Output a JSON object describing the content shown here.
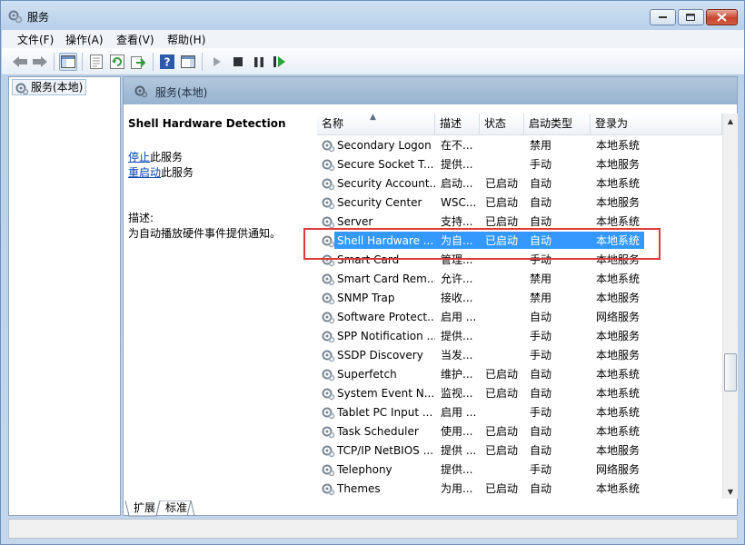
{
  "window": {
    "title": "服务"
  },
  "menu": [
    "文件(F)",
    "操作(A)",
    "查看(V)",
    "帮助(H)"
  ],
  "tree": {
    "root_label": "服务(本地)"
  },
  "pane_header": "服务(本地)",
  "detail": {
    "service_name": "Shell Hardware Detection",
    "stop_link": "停止",
    "stop_suffix": "此服务",
    "restart_link": "重启动",
    "restart_suffix": "此服务",
    "desc_label": "描述:",
    "desc_text": "为自动播放硬件事件提供通知。"
  },
  "columns": [
    "名称",
    "描述",
    "状态",
    "启动类型",
    "登录为"
  ],
  "rows": [
    {
      "name": "Secondary Logon",
      "desc": "在不...",
      "status": "",
      "start": "禁用",
      "logon": "本地系统"
    },
    {
      "name": "Secure Socket T...",
      "desc": "提供...",
      "status": "",
      "start": "手动",
      "logon": "本地服务"
    },
    {
      "name": "Security Account...",
      "desc": "启动...",
      "status": "已启动",
      "start": "自动",
      "logon": "本地系统"
    },
    {
      "name": "Security Center",
      "desc": "WSC...",
      "status": "已启动",
      "start": "自动",
      "logon": "本地服务"
    },
    {
      "name": "Server",
      "desc": "支持...",
      "status": "已启动",
      "start": "自动",
      "logon": "本地系统"
    },
    {
      "name": "Shell Hardware ...",
      "desc": "为自...",
      "status": "已启动",
      "start": "自动",
      "logon": "本地系统",
      "selected": true
    },
    {
      "name": "Smart Card",
      "desc": "管理...",
      "status": "",
      "start": "手动",
      "logon": "本地服务"
    },
    {
      "name": "Smart Card Rem...",
      "desc": "允许...",
      "status": "",
      "start": "禁用",
      "logon": "本地系统"
    },
    {
      "name": "SNMP Trap",
      "desc": "接收...",
      "status": "",
      "start": "禁用",
      "logon": "本地服务"
    },
    {
      "name": "Software Protect...",
      "desc": "启用 ...",
      "status": "",
      "start": "自动",
      "logon": "网络服务"
    },
    {
      "name": "SPP Notification ...",
      "desc": "提供...",
      "status": "",
      "start": "手动",
      "logon": "本地服务"
    },
    {
      "name": "SSDP Discovery",
      "desc": "当发...",
      "status": "",
      "start": "手动",
      "logon": "本地服务"
    },
    {
      "name": "Superfetch",
      "desc": "维护...",
      "status": "已启动",
      "start": "自动",
      "logon": "本地系统"
    },
    {
      "name": "System Event N...",
      "desc": "监视...",
      "status": "已启动",
      "start": "自动",
      "logon": "本地系统"
    },
    {
      "name": "Tablet PC Input ...",
      "desc": "启用 ...",
      "status": "",
      "start": "手动",
      "logon": "本地系统"
    },
    {
      "name": "Task Scheduler",
      "desc": "使用...",
      "status": "已启动",
      "start": "自动",
      "logon": "本地系统"
    },
    {
      "name": "TCP/IP NetBIOS ...",
      "desc": "提供 ...",
      "status": "已启动",
      "start": "自动",
      "logon": "本地服务"
    },
    {
      "name": "Telephony",
      "desc": "提供...",
      "status": "",
      "start": "手动",
      "logon": "网络服务"
    },
    {
      "name": "Themes",
      "desc": "为用...",
      "status": "已启动",
      "start": "自动",
      "logon": "本地系统"
    }
  ],
  "tabs": [
    "扩展",
    "标准"
  ],
  "colors": {
    "selection": "#3399ff",
    "highlight_box": "#e03a3a",
    "link": "#0645ad"
  }
}
